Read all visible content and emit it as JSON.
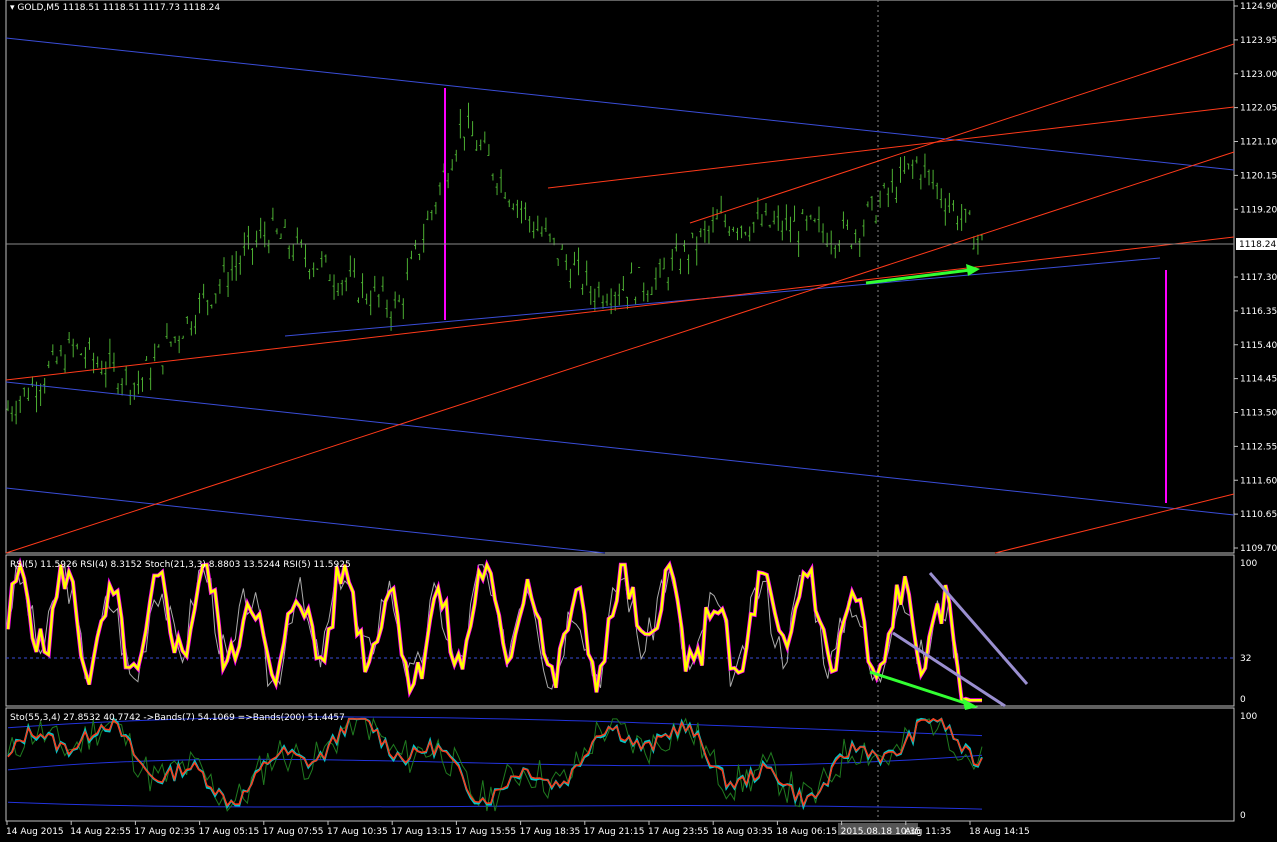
{
  "header": {
    "symbol": "GOLD,M5",
    "ohlc": "1118.51 1118.51 1117.73 1118.24",
    "current_price": "1118.24"
  },
  "rsi_panel": {
    "legend": "RSI(5) 11.5926  RSI(4) 8.3152  Stoch(21,3,3) 8.8803 13.5244  RSI(5) 11.5925",
    "levels": [
      "100",
      "32",
      "0"
    ]
  },
  "sto_panel": {
    "legend": "Sto(55,3,4) 27.8532 40.7742  ->Bands(7) 54.1069  =>Bands(200) 51.4457",
    "levels": [
      "100",
      "0"
    ]
  },
  "x_axis": {
    "labels": [
      "14 Aug 2015",
      "14 Aug 22:55",
      "17 Aug 02:35",
      "17 Aug 05:15",
      "17 Aug 07:55",
      "17 Aug 10:35",
      "17 Aug 13:15",
      "17 Aug 15:55",
      "17 Aug 18:35",
      "17 Aug 21:15",
      "17 Aug 23:55",
      "18 Aug 03:35",
      "18 Aug 06:15",
      "2015.08.18 10:35",
      "Aug 11:35",
      "18 Aug 14:15"
    ]
  },
  "colors": {
    "background": "#000000",
    "candles": "#4caf32",
    "trend_blue": "#3a4dd8",
    "trend_red": "#ff3a1a",
    "magenta": "#ff00ff",
    "arrow_green": "#32ff32",
    "rsi_yellow": "#ffff00",
    "divergence_line": "#9a8fd0"
  },
  "chart_data": [
    {
      "type": "line",
      "title": "GOLD,M5",
      "ylim": [
        1109.7,
        1124.9
      ],
      "y_ticks": [
        "1124.90",
        "1123.95",
        "1123.00",
        "1122.05",
        "1121.10",
        "1120.15",
        "1119.20",
        "1118.24",
        "1117.30",
        "1116.35",
        "1115.40",
        "1114.45",
        "1113.50",
        "1112.55",
        "1111.60",
        "1110.65",
        "1109.70"
      ],
      "x": [
        "14 Aug 2015",
        "14 Aug 22:55",
        "17 Aug 02:35",
        "17 Aug 05:15",
        "17 Aug 07:55",
        "17 Aug 10:35",
        "17 Aug 13:15",
        "17 Aug 15:55",
        "17 Aug 18:35",
        "17 Aug 21:15",
        "17 Aug 23:55",
        "18 Aug 03:35",
        "18 Aug 06:15",
        "18 Aug 10:35",
        "18 Aug 11:35",
        "18 Aug 14:15"
      ],
      "series": [
        {
          "values": [
            1113.6,
            1115.3,
            1114.3,
            1116.6,
            1118.6,
            1117.4,
            1116.4,
            1121.6,
            1119.0,
            1116.9,
            1117.2,
            1118.9,
            1118.7,
            1118.5,
            1120.5,
            1118.24
          ]
        }
      ]
    },
    {
      "type": "line",
      "title": "RSI(5) / RSI(4) / Stoch(21,3,3)",
      "ylim": [
        0,
        100
      ],
      "y_ticks": [
        "100",
        "32",
        "0"
      ]
    },
    {
      "type": "line",
      "title": "Sto(55,3,4) / Bands(7) / Bands(200)",
      "ylim": [
        0,
        100
      ],
      "y_ticks": [
        "100",
        "0"
      ]
    }
  ]
}
